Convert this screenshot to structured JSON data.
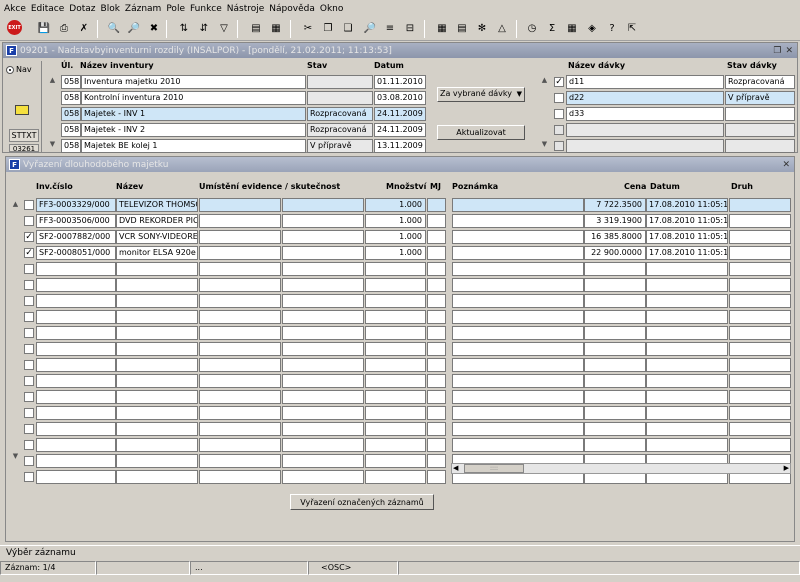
{
  "menu": [
    "Akce",
    "Editace",
    "Dotaz",
    "Blok",
    "Záznam",
    "Pole",
    "Funkce",
    "Nástroje",
    "Nápověda",
    "Okno"
  ],
  "window1": {
    "title": "09201 - Nadstavbyinventurni rozdily (INSALPOR) - [pondělí, 21.02.2011; 11:13:53]",
    "nav_label": "Nav",
    "side_buttons": [
      "STTXT",
      "03261"
    ],
    "inventory_headers": {
      "ul": "Úl.",
      "name": "Název inventury",
      "state": "Stav",
      "date": "Datum"
    },
    "inventories": [
      {
        "ul": "058",
        "name": "Inventura majetku 2010",
        "state": "",
        "date": "01.11.2010"
      },
      {
        "ul": "058",
        "name": "Kontrolní inventura 2010",
        "state": "",
        "date": "03.08.2010"
      },
      {
        "ul": "058",
        "name": "Majetek - INV 1",
        "state": "Rozpracovaná",
        "date": "24.11.2009"
      },
      {
        "ul": "058",
        "name": "Majetek - INV 2",
        "state": "Rozpracovaná",
        "date": "24.11.2009"
      },
      {
        "ul": "058",
        "name": "Majetek BE kolej 1",
        "state": "V přípravě",
        "date": "13.11.2009"
      }
    ],
    "filter_select": "Za vybrané dávky",
    "refresh_button": "Aktualizovat",
    "batch_headers": {
      "name": "Název dávky",
      "state": "Stav dávky"
    },
    "batches": [
      {
        "checked": true,
        "name": "d11",
        "state": "Rozpracovaná"
      },
      {
        "checked": false,
        "name": "d22",
        "state": "V přípravě"
      },
      {
        "checked": false,
        "name": "d33",
        "state": ""
      }
    ]
  },
  "window2": {
    "title": "Vyřazení dlouhodobého majetku",
    "headers": {
      "inv": "Inv.číslo",
      "name": "Název",
      "loc": "Umístění evidence / skutečnost",
      "qty": "Množství",
      "mj": "MJ",
      "note": "Poznámka",
      "price": "Cena",
      "date": "Datum",
      "kind": "Druh"
    },
    "rows": [
      {
        "checked": false,
        "inv": "FF3-0003329/000",
        "name": "TELEVIZOR THOMSC",
        "qty": "1.000",
        "price": "7 722.3500",
        "date": "17.08.2010 11:05:17"
      },
      {
        "checked": false,
        "inv": "FF3-0003506/000",
        "name": "DVD REKORDER PIOI",
        "qty": "1.000",
        "price": "3 319.1900",
        "date": "17.08.2010 11:05:17"
      },
      {
        "checked": true,
        "inv": "SF2-0007882/000",
        "name": "VCR SONY-VIDEORE",
        "qty": "1.000",
        "price": "16 385.8000",
        "date": "17.08.2010 11:05:17"
      },
      {
        "checked": true,
        "inv": "SF2-0008051/000",
        "name": "monitor ELSA  920e",
        "qty": "1.000",
        "price": "22 900.0000",
        "date": "17.08.2010 11:05:17"
      }
    ],
    "empty_rows": 14,
    "scroll_thumb": "::::",
    "discard_button": "Vyřazení označených záznamů"
  },
  "status": {
    "hint": "Výběr záznamu",
    "record": "Záznam: 1/4",
    "ellipsis": "...",
    "mode": "<OSC>"
  }
}
